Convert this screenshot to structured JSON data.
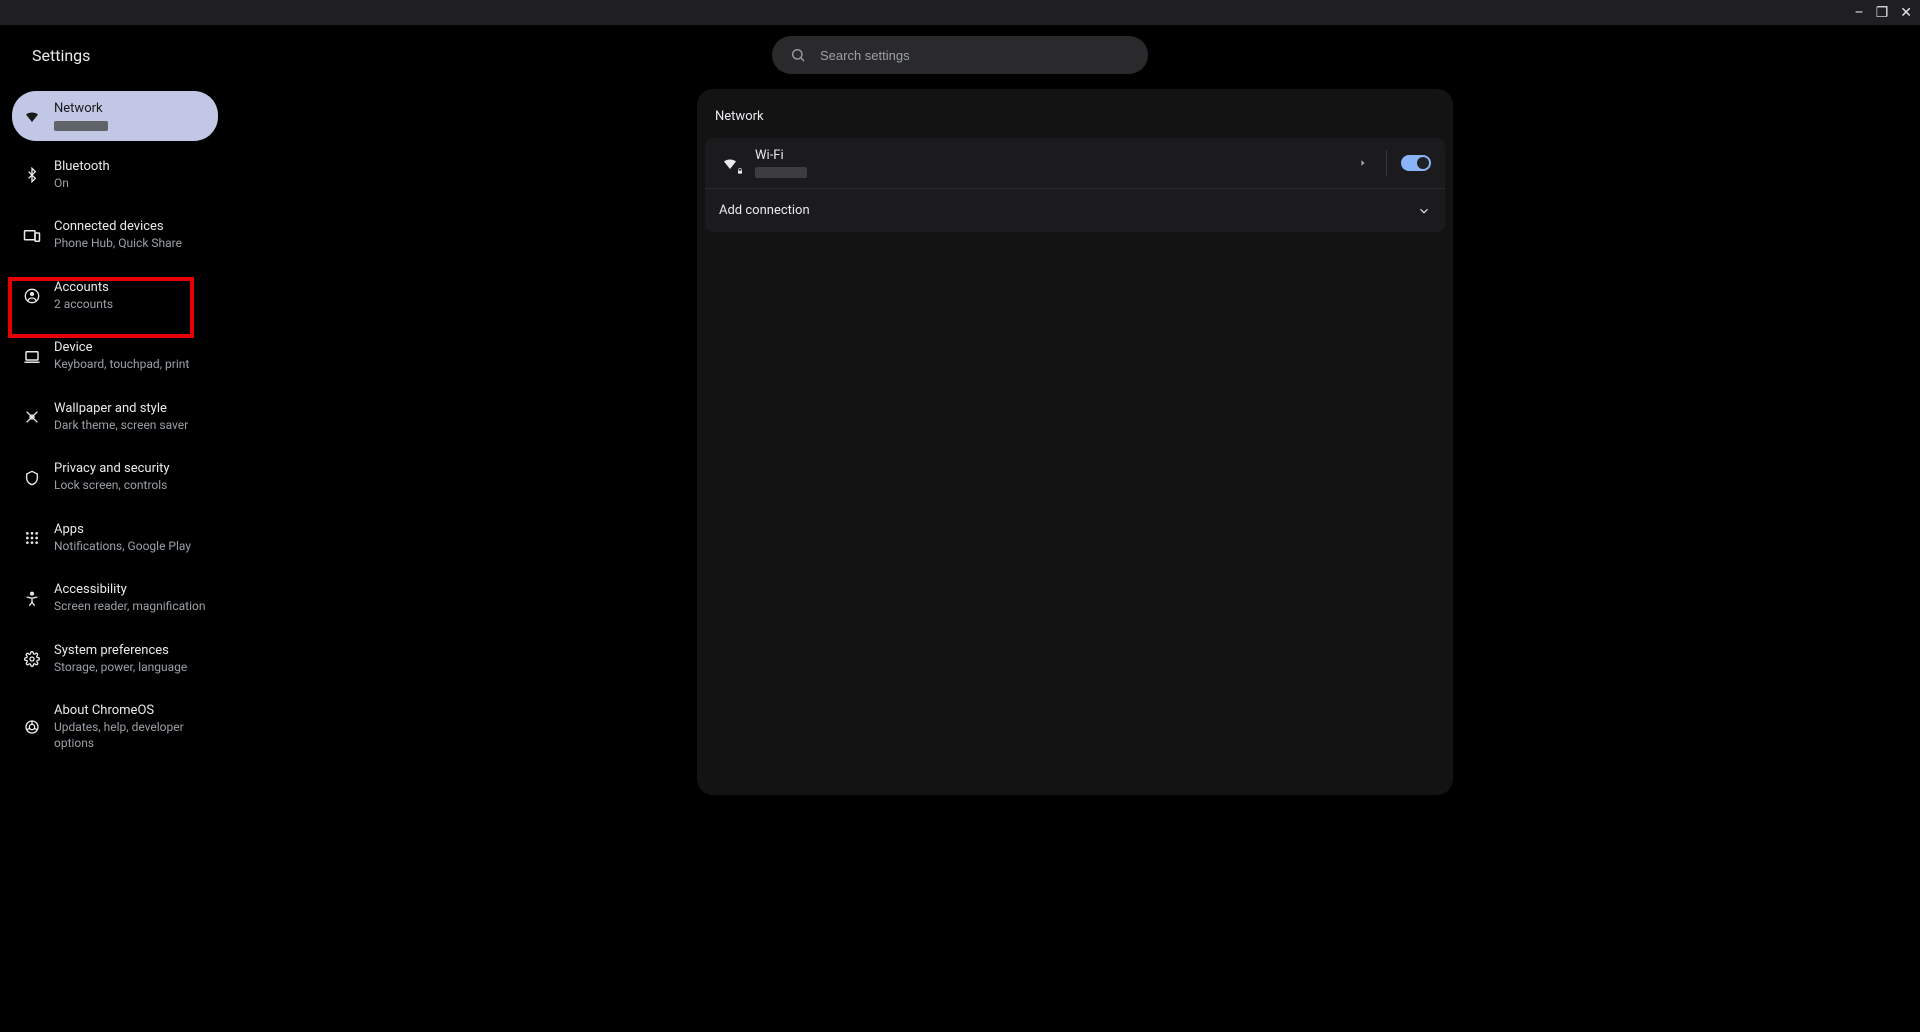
{
  "titlebar": {
    "minimize": "–",
    "maximize": "❐",
    "close": "✕"
  },
  "header": {
    "title": "Settings",
    "search_placeholder": "Search settings"
  },
  "sidebar": {
    "items": [
      {
        "title": "Network",
        "sub": ""
      },
      {
        "title": "Bluetooth",
        "sub": "On"
      },
      {
        "title": "Connected devices",
        "sub": "Phone Hub, Quick Share"
      },
      {
        "title": "Accounts",
        "sub": "2 accounts"
      },
      {
        "title": "Device",
        "sub": "Keyboard, touchpad, print"
      },
      {
        "title": "Wallpaper and style",
        "sub": "Dark theme, screen saver"
      },
      {
        "title": "Privacy and security",
        "sub": "Lock screen, controls"
      },
      {
        "title": "Apps",
        "sub": "Notifications, Google Play"
      },
      {
        "title": "Accessibility",
        "sub": "Screen reader, magnification"
      },
      {
        "title": "System preferences",
        "sub": "Storage, power, language"
      },
      {
        "title": "About ChromeOS",
        "sub": "Updates, help, developer options"
      }
    ]
  },
  "main": {
    "section_title": "Network",
    "wifi": {
      "label": "Wi-Fi",
      "ssid": "",
      "toggle_on": true
    },
    "add_connection": "Add connection"
  }
}
